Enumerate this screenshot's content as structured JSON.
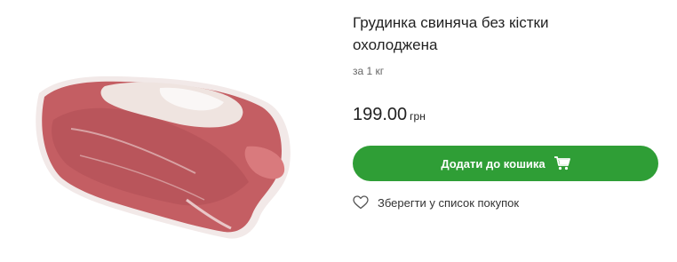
{
  "product": {
    "title": "Грудинка свиняча без кістки охолоджена",
    "unit": "за 1 кг",
    "price": "199.00",
    "currency": "грн"
  },
  "actions": {
    "add_to_cart_label": "Додати до кошика",
    "wishlist_label": "Зберегти у список покупок"
  },
  "colors": {
    "accent": "#2f9e36",
    "meat": "#c45e63",
    "fat": "#efe4e0"
  },
  "icons": {
    "cart": "cart-icon",
    "wishlist": "heart-icon"
  }
}
